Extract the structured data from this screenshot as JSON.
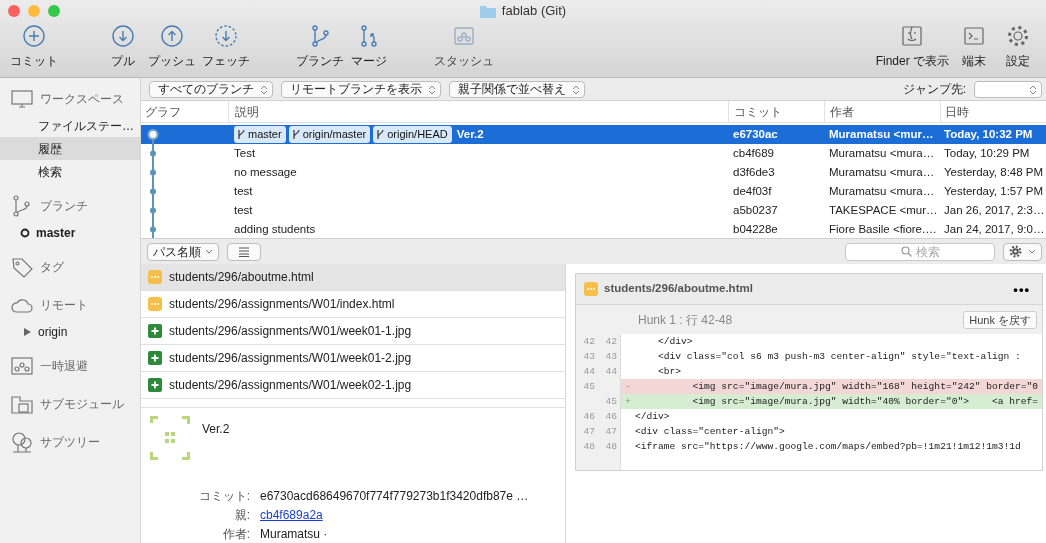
{
  "window": {
    "title": "fablab (Git)"
  },
  "toolbar": {
    "groups": [
      [
        {
          "label": "コミット",
          "kind": "commit",
          "disabled": false
        }
      ],
      [
        {
          "label": "プル",
          "kind": "pull",
          "disabled": false
        },
        {
          "label": "プッシュ",
          "kind": "push",
          "disabled": false
        },
        {
          "label": "フェッチ",
          "kind": "fetch",
          "disabled": false
        }
      ],
      [
        {
          "label": "ブランチ",
          "kind": "branch",
          "disabled": false
        },
        {
          "label": "マージ",
          "kind": "merge",
          "disabled": false
        }
      ],
      [
        {
          "label": "スタッシュ",
          "kind": "stash",
          "disabled": true
        }
      ]
    ],
    "right": [
      {
        "label": "Finder で表示",
        "kind": "finder"
      },
      {
        "label": "端末",
        "kind": "terminal"
      },
      {
        "label": "設定",
        "kind": "settings"
      }
    ]
  },
  "sidebar": [
    {
      "label": "ワークスペース",
      "kind": "workspace",
      "children": [
        {
          "label": "ファイルステー…",
          "selected": false
        },
        {
          "label": "履歴",
          "selected": true
        },
        {
          "label": "検索",
          "selected": false
        }
      ]
    },
    {
      "label": "ブランチ",
      "kind": "branch",
      "children": [
        {
          "label": "master",
          "selected": false,
          "kind": "current-branch"
        }
      ]
    },
    {
      "label": "タグ",
      "kind": "tag"
    },
    {
      "label": "リモート",
      "kind": "remote",
      "children": [
        {
          "label": "origin",
          "selected": false,
          "kind": "remote",
          "expanded": false
        }
      ]
    },
    {
      "label": "一時退避",
      "kind": "stash"
    },
    {
      "label": "サブモジュール",
      "kind": "submodule"
    },
    {
      "label": "サブツリー",
      "kind": "subtree"
    }
  ],
  "filters": {
    "dropdowns": [
      "すべてのブランチ",
      "リモートブランチを表示",
      "親子関係で並べ替え"
    ],
    "jump_label": "ジャンプ先:"
  },
  "history": {
    "columns": [
      "グラフ",
      "説明",
      "コミット",
      "作者",
      "日時"
    ],
    "rows": [
      {
        "tags": [
          "master",
          "origin/master",
          "origin/HEAD"
        ],
        "description": "Ver.2",
        "commit": "e6730ac",
        "author": "Muramatsu <mur…",
        "date": "Today, 10:32 PM",
        "selected": true
      },
      {
        "description": "Test",
        "commit": "cb4f689",
        "author": "Muramatsu <mura…",
        "date": "Today, 10:29 PM",
        "selected": false
      },
      {
        "description": "no message",
        "commit": "d3f6de3",
        "author": "Muramatsu <mura…",
        "date": "Yesterday, 8:48 PM",
        "selected": false
      },
      {
        "description": "test",
        "commit": "de4f03f",
        "author": "Muramatsu <mura…",
        "date": "Yesterday, 1:57 PM",
        "selected": false
      },
      {
        "description": "test",
        "commit": "a5b0237",
        "author": "TAKESPACE <mur…",
        "date": "Jan 26, 2017, 2:3…",
        "selected": false
      },
      {
        "description": "adding students",
        "commit": "b04228e",
        "author": "Fiore Basile <fiore.…",
        "date": "Jan 24, 2017, 9:0…",
        "selected": false
      }
    ]
  },
  "file_toolbar": {
    "sort": "パス名順",
    "search_placeholder": "検索"
  },
  "files": [
    {
      "path": "students/296/aboutme.html",
      "kind": "modified",
      "selected": true
    },
    {
      "path": "students/296/assignments/W01/index.html",
      "kind": "modified",
      "selected": false
    },
    {
      "path": "students/296/assignments/W01/week01-1.jpg",
      "kind": "added",
      "selected": false
    },
    {
      "path": "students/296/assignments/W01/week01-2.jpg",
      "kind": "added",
      "selected": false
    },
    {
      "path": "students/296/assignments/W01/week02-1.jpg",
      "kind": "added",
      "selected": false
    }
  ],
  "commit": {
    "message": "Ver.2",
    "fields": [
      {
        "label": "コミット:",
        "value": "e6730acd68649670f774f779273b1f3420dfb87e …",
        "kind": "text"
      },
      {
        "label": "親:",
        "value": "cb4f689a2a",
        "kind": "link"
      },
      {
        "label": "作者:",
        "value": "Muramatsu ·",
        "kind": "text"
      }
    ]
  },
  "diff": {
    "file": "students/296/aboutme.html",
    "kind": "modified",
    "more_label": "•••",
    "hunk_title": "Hunk 1 : 行 42-48",
    "hunk_button": "Hunk を戻す",
    "lines": [
      {
        "old": "42",
        "new": "42",
        "kind": "context",
        "code": "    </div>"
      },
      {
        "old": "43",
        "new": "43",
        "kind": "context",
        "code": "    <div class=\"col s6 m3 push-m3 center-align\" style=\"text-align : "
      },
      {
        "old": "44",
        "new": "44",
        "kind": "context",
        "code": "    <br>"
      },
      {
        "old": "45",
        "kind": "removed",
        "sign": "-",
        "code": "          <img src=\"image/mura.jpg\" width=\"168\" height=\"242\" border=\"0"
      },
      {
        "new": "45",
        "kind": "added",
        "sign": "+",
        "code": "          <img src=\"image/mura.jpg\" width=\"40% border=\"0\">    <a href="
      },
      {
        "old": "46",
        "new": "46",
        "kind": "context",
        "code": "</div>"
      },
      {
        "old": "47",
        "new": "47",
        "kind": "context",
        "code": "<div class=\"center-align\">"
      },
      {
        "old": "48",
        "new": "48",
        "kind": "context",
        "code": "<iframe src=\"https://www.google.com/maps/embed?pb=!1m21!1m12!1m3!1d"
      }
    ]
  }
}
